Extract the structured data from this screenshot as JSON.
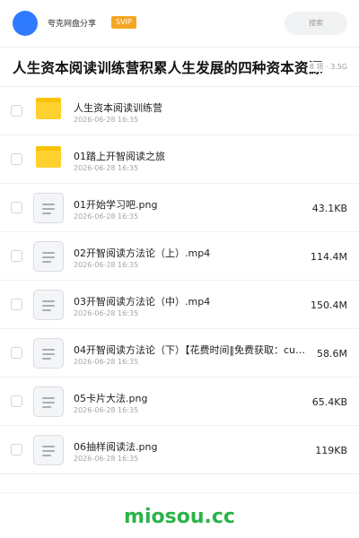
{
  "header": {
    "user_name": "夸克网盘分享",
    "badge": "SVIP",
    "search_placeholder": "搜索"
  },
  "share": {
    "title": "人生资本阅读训练营积累人生发展的四种资本资源",
    "meta": "8 项 · 3.5G"
  },
  "files": [
    {
      "name": "人生资本阅读训练营",
      "date": "2026-06-28 16:35",
      "size": "",
      "type": "folder"
    },
    {
      "name": "01踏上开智阅读之旅",
      "date": "2026-06-28 16:35",
      "size": "",
      "type": "folder"
    },
    {
      "name": "01开始学习吧.png",
      "date": "2026-06-28 16:35",
      "size": "43.1KB",
      "type": "file"
    },
    {
      "name": "02开智阅读方法论（上）.mp4",
      "date": "2026-06-28 16:35",
      "size": "114.4M",
      "type": "file"
    },
    {
      "name": "03开智阅读方法论（中）.mp4",
      "date": "2026-06-28 16:35",
      "size": "150.4M",
      "type": "file"
    },
    {
      "name": "04开智阅读方法论（下）【花费时间‖免费获取：cu…",
      "date": "2026-06-28 16:35",
      "size": "58.6M",
      "type": "file"
    },
    {
      "name": "05卡片大法.png",
      "date": "2026-06-28 16:35",
      "size": "65.4KB",
      "type": "file"
    },
    {
      "name": "06抽样阅读法.png",
      "date": "2026-06-28 16:35",
      "size": "119KB",
      "type": "file"
    }
  ],
  "footer": {
    "watermark": "miosou.cc"
  },
  "colors": {
    "avatar": "#2f7bff",
    "badge": "#f5a623",
    "folder": "#ffd12e",
    "watermark": "#2bb34a"
  }
}
